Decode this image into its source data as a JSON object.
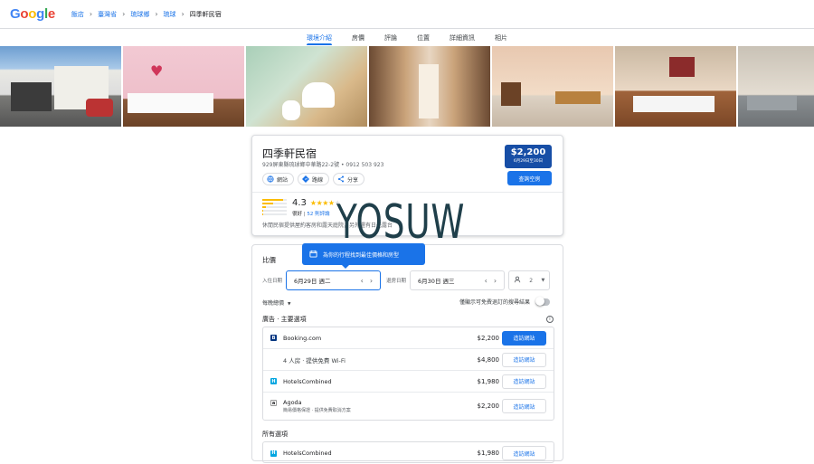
{
  "header": {
    "logo": "Google",
    "breadcrumbs": [
      "飯店",
      "臺灣省",
      "琉球鄉",
      "琉球",
      "四季軒民宿"
    ]
  },
  "tabs": [
    "環境介紹",
    "房價",
    "評論",
    "位置",
    "詳細資訊",
    "相片"
  ],
  "hotel": {
    "name": "四季軒民宿",
    "address": "929屏東縣琉球鄉中華路22-2號 • 0912 503 923",
    "actions": {
      "website": "網站",
      "directions": "路線",
      "share": "分享"
    },
    "price": "$2,200",
    "price_dates": "6月29日至30日",
    "check_availability": "查詢空房",
    "rating": "4.3",
    "stars_filled": 4,
    "rating_word": "很好",
    "review_count": "52 則評論",
    "description": "休閒民宿提供屋約客房和露天庭院，另外還有日光露台"
  },
  "watermark": "YOSUW",
  "pricing": {
    "title": "比價",
    "tooltip": "為你的行程找到最佳價格和房型",
    "checkin_label": "入住日期",
    "checkin_value": "6月29日 週二",
    "checkout_label": "退房日期",
    "checkout_value": "6月30日 週三",
    "guests": "2",
    "rate_selector": "每晚總價",
    "free_cancel_label": "僅顯示可免費退訂的搜尋結果",
    "sponsored_header": "廣告 · 主要選項",
    "all_header": "所有選項",
    "offers": [
      {
        "name": "Booking.com",
        "sub": "",
        "price": "$2,200",
        "button": "造訪網站",
        "logo_color": "#003580",
        "logo_text": "B"
      },
      {
        "name": "4 人房 · 提供免費 Wi-Fi",
        "sub": "",
        "price": "$4,800",
        "button": "造訪網站"
      },
      {
        "name": "HotelsCombined",
        "sub": "",
        "price": "$1,980",
        "button": "造訪網站",
        "logo_color": "#00a5e0",
        "logo_text": "H"
      },
      {
        "name": "Agoda",
        "sub": "簡易價格保證 · 提供免費取消方案",
        "price": "$2,200",
        "button": "造訪網站",
        "logo_color": "#ffffff",
        "logo_text": "a"
      }
    ],
    "all_offers": [
      {
        "name": "HotelsCombined",
        "price": "$1,980",
        "button": "造訪網站",
        "logo_color": "#00a5e0",
        "logo_text": "H"
      }
    ]
  }
}
